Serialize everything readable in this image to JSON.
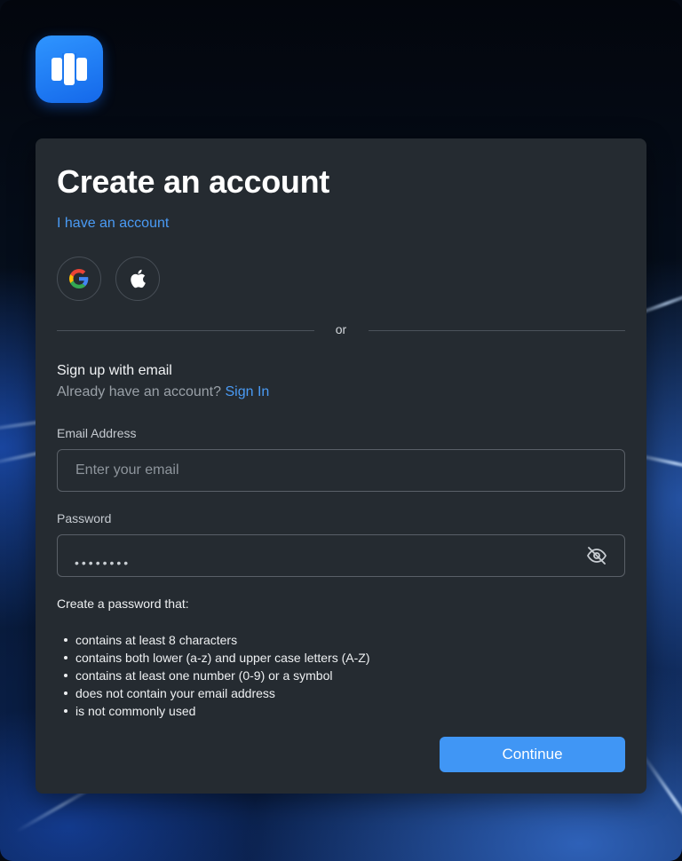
{
  "app": {
    "logo_name": "brand-logo-icon",
    "accent": "#4096f5",
    "link_color": "#4a9bf5",
    "card_color": "#252b31"
  },
  "form": {
    "title": "Create an account",
    "have_account_link": "I have an account",
    "social": [
      {
        "icon": "google-icon",
        "provider": "Google"
      },
      {
        "icon": "apple-icon",
        "provider": "Apple"
      }
    ],
    "divider_text": "or",
    "email_section_title": "Sign up with email",
    "already_text": "Already have an account?",
    "sign_in_link": "Sign In",
    "email": {
      "label": "Email Address",
      "placeholder": "Enter your email",
      "value": ""
    },
    "password": {
      "label": "Password",
      "masked_value": "••••••••",
      "toggle_icon": "eye-off-icon"
    },
    "password_rules_intro": "Create a password that:",
    "password_rules": [
      "contains at least 8 characters",
      "contains both lower (a-z) and upper case letters (A-Z)",
      "contains at least one number (0-9) or a symbol",
      "does not contain your email address",
      "is not commonly used"
    ],
    "continue_label": "Continue"
  }
}
